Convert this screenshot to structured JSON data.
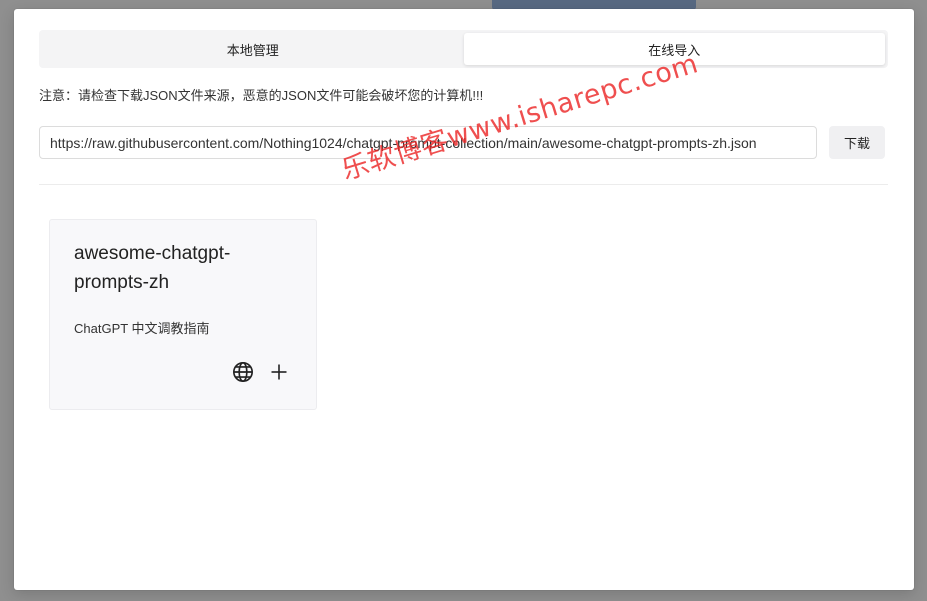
{
  "tabs": [
    {
      "label": "本地管理",
      "active": false
    },
    {
      "label": "在线导入",
      "active": true
    }
  ],
  "notice": "注意：请检查下载JSON文件来源，恶意的JSON文件可能会破坏您的计算机!!!",
  "url_input": {
    "value": "https://raw.githubusercontent.com/Nothing1024/chatgpt-prompt-collection/main/awesome-chatgpt-prompts-zh.json"
  },
  "download_button": {
    "label": "下载"
  },
  "cards": [
    {
      "title": "awesome-chatgpt-prompts-zh",
      "description": "ChatGPT 中文调教指南",
      "icons": [
        "globe-icon",
        "plus-icon"
      ]
    }
  ],
  "watermark": "乐软博客www.isharepc.com",
  "colors": {
    "overlay": "#8f8f8f",
    "modal_bg": "#ffffff",
    "tab_bar_bg": "#f4f4f5",
    "card_bg": "#f8f8fa",
    "watermark": "#eb2828"
  }
}
